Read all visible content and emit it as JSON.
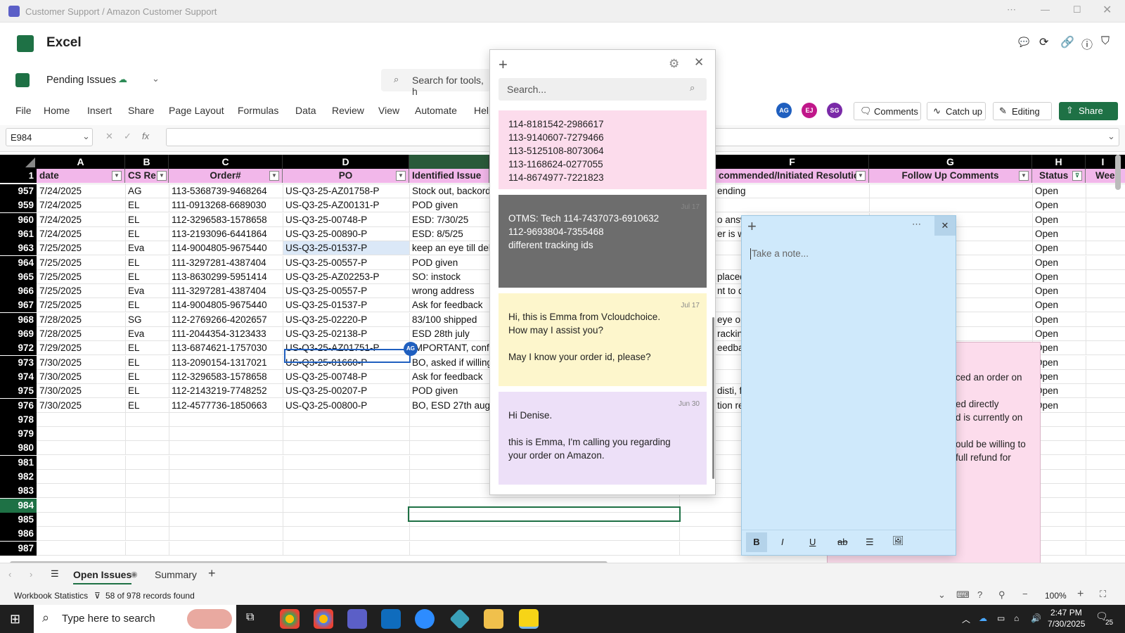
{
  "window": {
    "title": "Customer Support / Amazon Customer Support"
  },
  "app": {
    "name": "Excel",
    "file_name": "Pending Issues"
  },
  "ribbon": {
    "tabs": [
      "File",
      "Home",
      "Insert",
      "Share",
      "Page Layout",
      "Formulas",
      "Data",
      "Review",
      "View",
      "Automate",
      "Help"
    ],
    "search_placeholder": "Search for tools, h",
    "avatars": [
      "AG",
      "EJ",
      "SG"
    ],
    "comments_label": "Comments",
    "catchup_label": "Catch up",
    "editing_label": "Editing",
    "share_label": "Share"
  },
  "formula_bar": {
    "cell_ref": "E984",
    "fx": "fx"
  },
  "grid": {
    "column_letters": [
      "A",
      "B",
      "C",
      "D",
      "",
      "F",
      "G",
      "H",
      "I"
    ],
    "header_row_number": "1",
    "headers": {
      "a": "date",
      "b": "CS Re",
      "c": "Order#",
      "d": "PO",
      "e": "Identified Issue",
      "f": "commended/Initiated Resolution",
      "g": "Follow Up Comments",
      "h": "Status",
      "i": "Weel"
    },
    "rows": [
      {
        "n": "957",
        "a": "7/24/2025",
        "b": "AG",
        "c": "113-5368739-9468264",
        "d": "US-Q3-25-AZ01758-P",
        "e": "Stock out, backorde",
        "f": "ending",
        "h": "Open"
      },
      {
        "n": "959",
        "a": "7/24/2025",
        "b": "EL",
        "c": "111-0913268-6689030",
        "d": "US-Q3-25-AZ00131-P",
        "e": "POD given",
        "f": "",
        "h": "Open"
      },
      {
        "n": "960",
        "a": "7/24/2025",
        "b": "EL",
        "c": "112-3296583-1578658",
        "d": "US-Q3-25-00748-P",
        "e": "ESD: 7/30/25",
        "f": "o answ",
        "h": "Open"
      },
      {
        "n": "961",
        "a": "7/24/2025",
        "b": "EL",
        "c": "113-2193096-6441864",
        "d": "US-Q3-25-00890-P",
        "e": "ESD: 8/5/25",
        "f": "er is wi",
        "h": "Open"
      },
      {
        "n": "963",
        "a": "7/25/2025",
        "b": "Eva",
        "c": "114-9004805-9675440",
        "d": "US-Q3-25-01537-P",
        "e": "keep an eye till deliv",
        "f": "",
        "h": "Open"
      },
      {
        "n": "964",
        "a": "7/25/2025",
        "b": "EL",
        "c": "111-3297281-4387404",
        "d": "US-Q3-25-00557-P",
        "e": "POD given",
        "f": "",
        "h": "Open"
      },
      {
        "n": "965",
        "a": "7/25/2025",
        "b": "EL",
        "c": "113-8630299-5951414",
        "d": "US-Q3-25-AZ02253-P",
        "e": "SO: instock",
        "f": "placed,",
        "h": "Open"
      },
      {
        "n": "966",
        "a": "7/25/2025",
        "b": "Eva",
        "c": "111-3297281-4387404",
        "d": "US-Q3-25-00557-P",
        "e": "wrong address",
        "f": "nt to d",
        "h": "Open"
      },
      {
        "n": "967",
        "a": "7/25/2025",
        "b": "EL",
        "c": "114-9004805-9675440",
        "d": "US-Q3-25-01537-P",
        "e": "Ask for feedback",
        "f": "",
        "h": "Open"
      },
      {
        "n": "968",
        "a": "7/28/2025",
        "b": "SG",
        "c": "112-2769266-4202657",
        "d": "US-Q3-25-02220-P",
        "e": "83/100 shipped",
        "f": "eye on",
        "h": "Open"
      },
      {
        "n": "969",
        "a": "7/28/2025",
        "b": "Eva",
        "c": "111-2044354-3123433",
        "d": "US-Q3-25-02138-P",
        "e": "ESD 28th july",
        "f": "rackin",
        "h": "Open"
      },
      {
        "n": "972",
        "a": "7/29/2025",
        "b": "EL",
        "c": "113-6874621-1757030",
        "d": "US-Q3-25-AZ01751-P",
        "e": "IMPORTANT, confirm",
        "f": "eedbac",
        "h": "Open"
      },
      {
        "n": "973",
        "a": "7/30/2025",
        "b": "EL",
        "c": "113-2090154-1317021",
        "d": "US-Q3-25-01660-P",
        "e": "BO, asked if willing t",
        "f": "",
        "h": "Open"
      },
      {
        "n": "974",
        "a": "7/30/2025",
        "b": "EL",
        "c": "112-3296583-1578658",
        "d": "US-Q3-25-00748-P",
        "e": "Ask for feedback",
        "f": "",
        "h": "Open"
      },
      {
        "n": "975",
        "a": "7/30/2025",
        "b": "EL",
        "c": "112-2143219-7748252",
        "d": "US-Q3-25-00207-P",
        "e": "POD given",
        "f": "disti, f",
        "h": "Open"
      },
      {
        "n": "976",
        "a": "7/30/2025",
        "b": "EL",
        "c": "112-4577736-1850663",
        "d": "US-Q3-25-00800-P",
        "e": "BO, ESD 27th aug",
        "f": "tion re",
        "h": "Open"
      }
    ],
    "empty_rows": [
      "978",
      "979",
      "980",
      "981",
      "982",
      "983",
      "984",
      "985",
      "986",
      "987"
    ],
    "cursor_avatar": "AG"
  },
  "sticky_list": {
    "search_placeholder": "Search...",
    "notes": [
      {
        "date": "",
        "lines": [
          "114-8181542-2986617",
          "113-9140607-7279466",
          "113-5125108-8073064",
          "113-1168624-0277055",
          "114-8674977-7221823"
        ]
      },
      {
        "date": "Jul 17",
        "lines": [
          "OTMS: Tech 114-7437073-6910632",
          "112-9693804-7355468",
          "different tracking ids"
        ]
      },
      {
        "date": "Jul 17",
        "lines": [
          "Hi, this is Emma from Vcloudchoice.",
          "How may I assist you?",
          "",
          "May I know your order id, please?"
        ]
      },
      {
        "date": "Jun 30",
        "lines": [
          "Hi Denise.",
          "",
          "this is Emma, I'm calling you regarding",
          "your order on Amazon."
        ]
      }
    ]
  },
  "new_note": {
    "placeholder": "Take a note..."
  },
  "pink_note": {
    "lines": [
      "ced an order on",
      "",
      "ed directly",
      "d is currently on",
      "",
      "ould be willing to",
      "full refund for"
    ]
  },
  "sheet_tabs": {
    "active": "Open Issues",
    "other": "Summary"
  },
  "status_bar": {
    "left": "Workbook Statistics",
    "records": "58 of 978 records found",
    "zoom": "100%"
  },
  "taskbar": {
    "search_placeholder": "Type here to search",
    "time": "2:47 PM",
    "date": "7/30/2025",
    "notif": "25"
  }
}
